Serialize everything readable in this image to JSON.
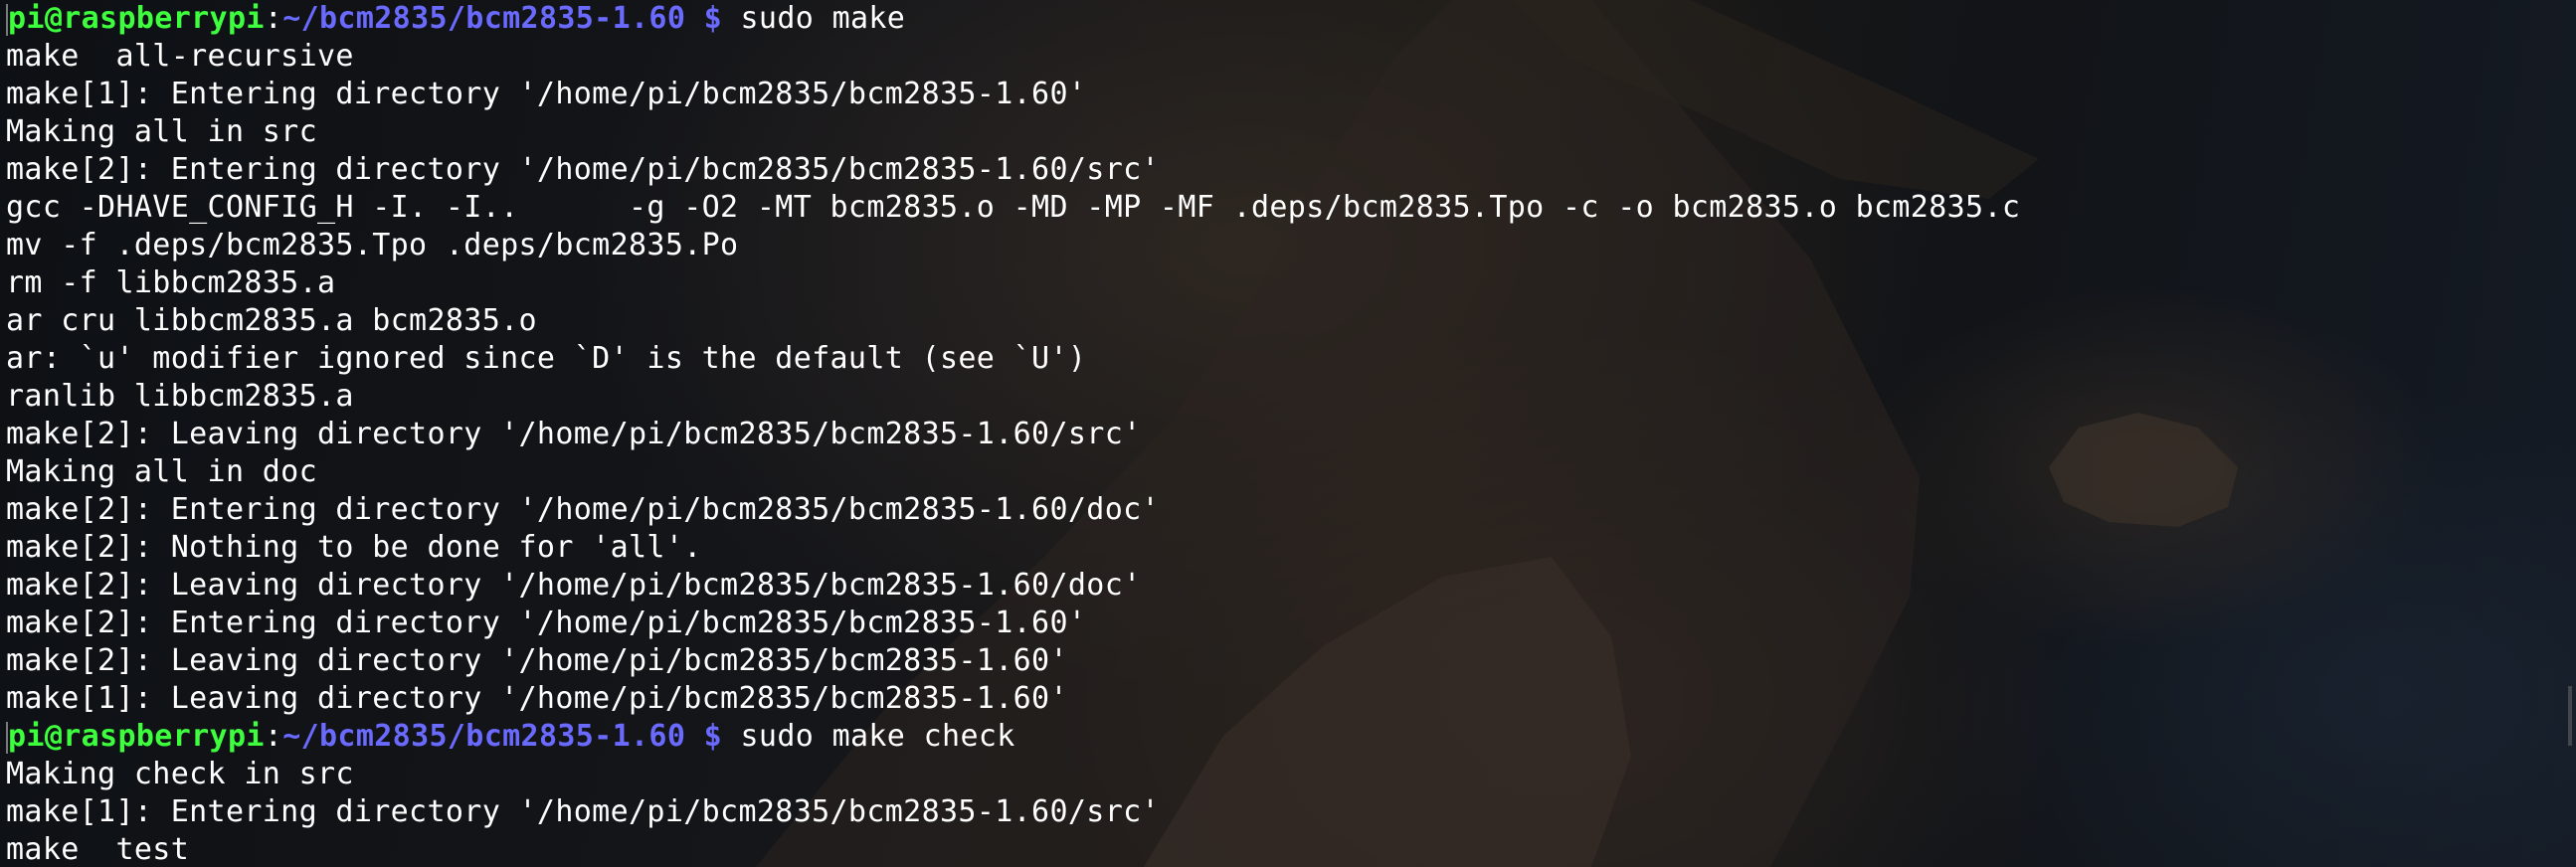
{
  "terminal": {
    "prompt": {
      "user_host": "pi@raspberrypi",
      "separator": ":",
      "path": "~/bcm2835/bcm2835-1.60",
      "symbol": "$"
    },
    "commands": [
      "sudo make",
      "sudo make check"
    ],
    "output_block_1": [
      "make  all-recursive",
      "make[1]: Entering directory '/home/pi/bcm2835/bcm2835-1.60'",
      "Making all in src",
      "make[2]: Entering directory '/home/pi/bcm2835/bcm2835-1.60/src'",
      "gcc -DHAVE_CONFIG_H -I. -I..      -g -O2 -MT bcm2835.o -MD -MP -MF .deps/bcm2835.Tpo -c -o bcm2835.o bcm2835.c",
      "mv -f .deps/bcm2835.Tpo .deps/bcm2835.Po",
      "rm -f libbcm2835.a",
      "ar cru libbcm2835.a bcm2835.o",
      "ar: `u' modifier ignored since `D' is the default (see `U')",
      "ranlib libbcm2835.a",
      "make[2]: Leaving directory '/home/pi/bcm2835/bcm2835-1.60/src'",
      "Making all in doc",
      "make[2]: Entering directory '/home/pi/bcm2835/bcm2835-1.60/doc'",
      "make[2]: Nothing to be done for 'all'.",
      "make[2]: Leaving directory '/home/pi/bcm2835/bcm2835-1.60/doc'",
      "make[2]: Entering directory '/home/pi/bcm2835/bcm2835-1.60'",
      "make[2]: Leaving directory '/home/pi/bcm2835/bcm2835-1.60'",
      "make[1]: Leaving directory '/home/pi/bcm2835/bcm2835-1.60'"
    ],
    "output_block_2": [
      "Making check in src",
      "make[1]: Entering directory '/home/pi/bcm2835/bcm2835-1.60/src'",
      "make  test"
    ],
    "colors": {
      "prompt_user": "#3dff3d",
      "prompt_path": "#6a6aff",
      "text": "#ffffff"
    }
  }
}
